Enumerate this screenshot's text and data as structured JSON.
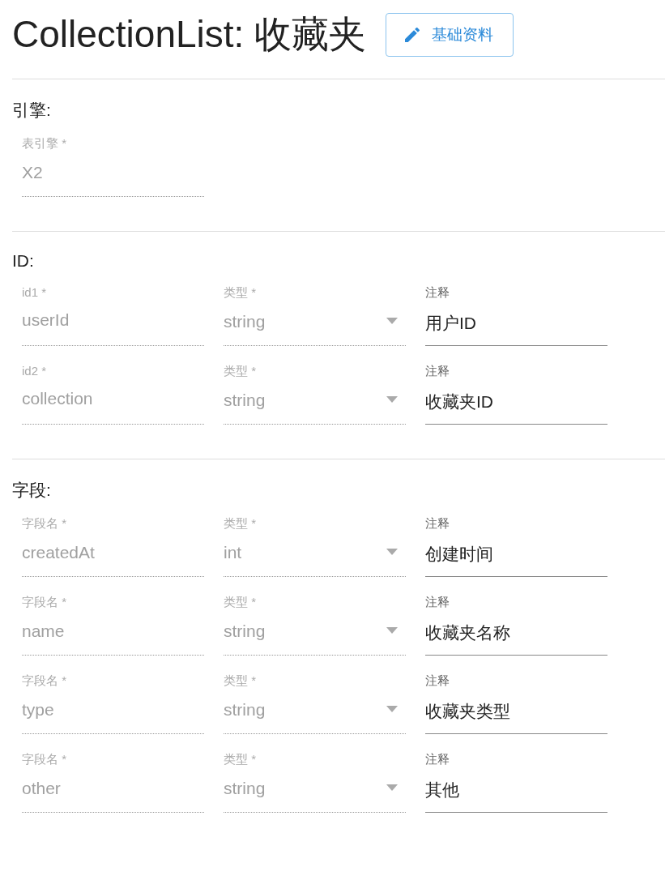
{
  "title": "CollectionList: 收藏夹",
  "edit_button": {
    "label": "基础资料"
  },
  "sections": [
    {
      "heading": "引擎:",
      "rows": [
        [
          {
            "kind": "text",
            "label": "表引擎 *",
            "value": "X2",
            "disabled": true
          }
        ]
      ]
    },
    {
      "heading": "ID:",
      "rows": [
        [
          {
            "kind": "text",
            "label": "id1 *",
            "value": "userId",
            "disabled": true
          },
          {
            "kind": "select",
            "label": "类型 *",
            "value": "string",
            "disabled": true
          },
          {
            "kind": "text",
            "label": "注释",
            "value": "用户ID",
            "disabled": false
          }
        ],
        [
          {
            "kind": "text",
            "label": "id2 *",
            "value": "collection",
            "disabled": true
          },
          {
            "kind": "select",
            "label": "类型 *",
            "value": "string",
            "disabled": true
          },
          {
            "kind": "text",
            "label": "注释",
            "value": "收藏夹ID",
            "disabled": false
          }
        ]
      ]
    },
    {
      "heading": "字段:",
      "rows": [
        [
          {
            "kind": "text",
            "label": "字段名 *",
            "value": "createdAt",
            "disabled": true
          },
          {
            "kind": "select",
            "label": "类型 *",
            "value": "int",
            "disabled": true
          },
          {
            "kind": "text",
            "label": "注释",
            "value": "创建时间",
            "disabled": false
          }
        ],
        [
          {
            "kind": "text",
            "label": "字段名 *",
            "value": "name",
            "disabled": true
          },
          {
            "kind": "select",
            "label": "类型 *",
            "value": "string",
            "disabled": true
          },
          {
            "kind": "text",
            "label": "注释",
            "value": "收藏夹名称",
            "disabled": false
          }
        ],
        [
          {
            "kind": "text",
            "label": "字段名 *",
            "value": "type",
            "disabled": true
          },
          {
            "kind": "select",
            "label": "类型 *",
            "value": "string",
            "disabled": true
          },
          {
            "kind": "text",
            "label": "注释",
            "value": "收藏夹类型",
            "disabled": false
          }
        ],
        [
          {
            "kind": "text",
            "label": "字段名 *",
            "value": "other",
            "disabled": true
          },
          {
            "kind": "select",
            "label": "类型 *",
            "value": "string",
            "disabled": true
          },
          {
            "kind": "text",
            "label": "注释",
            "value": "其他",
            "disabled": false
          }
        ]
      ]
    }
  ]
}
